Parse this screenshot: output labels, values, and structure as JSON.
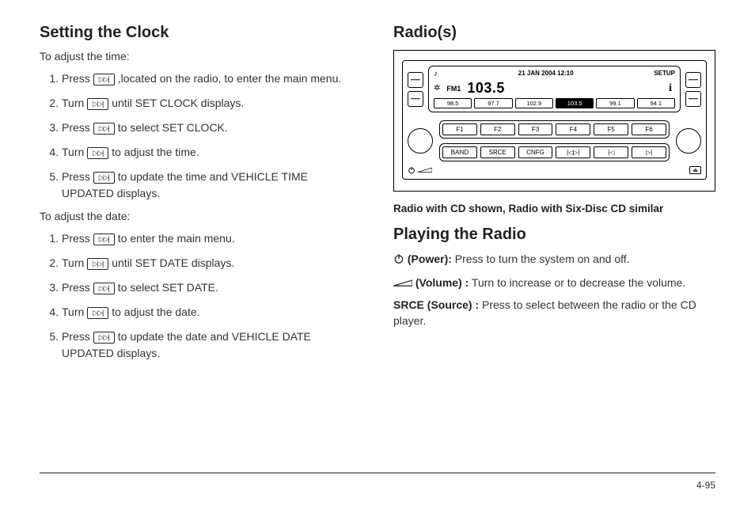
{
  "left": {
    "heading": "Setting the Clock",
    "intro_time": "To adjust the time:",
    "steps_time": [
      {
        "pre": "Press ",
        "post": " ,located on the radio, to enter the main menu."
      },
      {
        "pre": "Turn ",
        "post": " until SET CLOCK displays."
      },
      {
        "pre": "Press ",
        "post": " to select SET CLOCK."
      },
      {
        "pre": "Turn ",
        "post": " to adjust the time."
      },
      {
        "pre": "Press ",
        "post": " to update the time and VEHICLE TIME UPDATED displays."
      }
    ],
    "intro_date": "To adjust the date:",
    "steps_date": [
      {
        "pre": "Press ",
        "post": " to enter the main menu."
      },
      {
        "pre": "Turn ",
        "post": " until SET DATE displays."
      },
      {
        "pre": "Press ",
        "post": " to select SET DATE."
      },
      {
        "pre": "Turn ",
        "post": " to adjust the date."
      },
      {
        "pre": "Press ",
        "post": " to update the date and VEHICLE DATE UPDATED displays."
      }
    ]
  },
  "right": {
    "heading": "Radio(s)",
    "caption": "Radio with CD shown, Radio with Six-Disc CD similar",
    "sub_heading": "Playing the Radio",
    "power": {
      "label": "(Power):",
      "text": "  Press to turn the system on and off."
    },
    "volume": {
      "label": "(Volume) :",
      "text": "  Turn to increase or to decrease the volume."
    },
    "srce": {
      "label": "SRCE (Source) :",
      "text": "  Press to select between the radio or the CD player."
    }
  },
  "radio_illustration": {
    "datetime": "21 JAN 2004 12:10",
    "setup": "SETUP",
    "band": "FM1",
    "freq": "103.5",
    "presets": [
      "98.5",
      "97.7",
      "102.9",
      "103.5",
      "99.1",
      "94.1"
    ],
    "active_preset_index": 3,
    "fkeys": [
      "F1",
      "F2",
      "F3",
      "F4",
      "F5",
      "F6"
    ],
    "row2": [
      "BAND",
      "SRCE",
      "CNFG",
      "|◁▷|",
      "|◁",
      "▷|"
    ],
    "eject_hint": "⏏"
  },
  "page_number": "4-95",
  "icons": {
    "menu_glyph": "▷▷|"
  }
}
